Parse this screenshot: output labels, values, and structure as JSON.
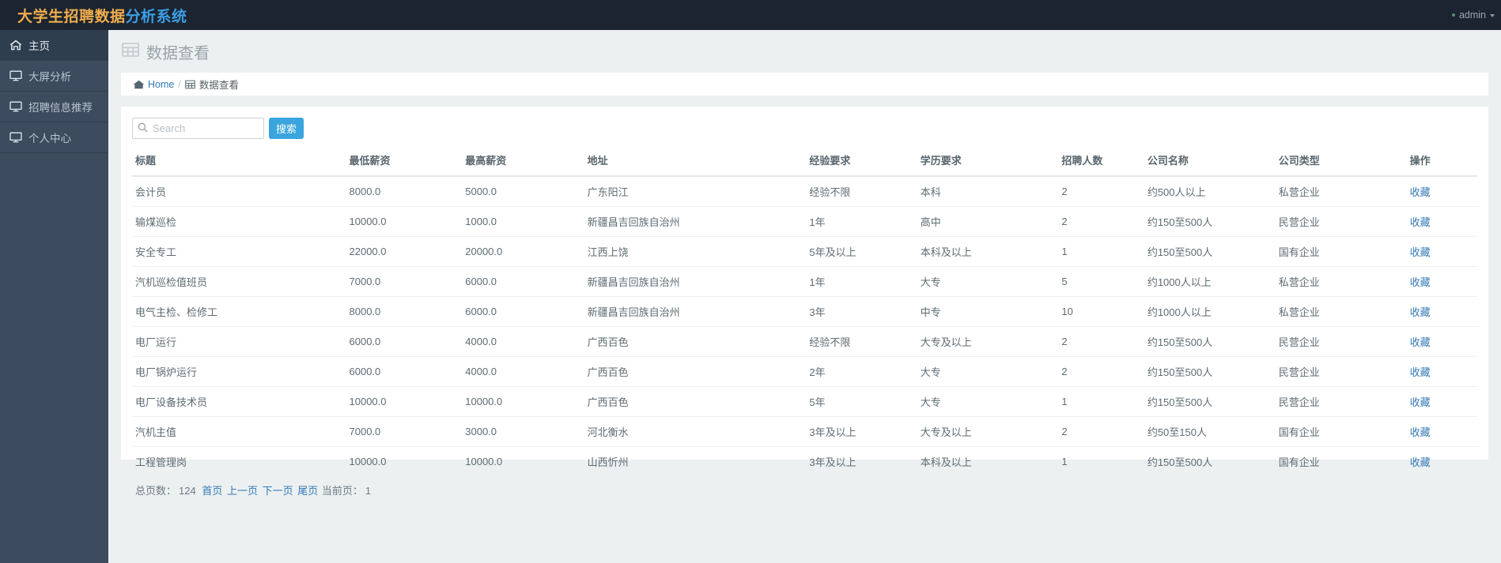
{
  "topbar": {
    "brand_part1": "大学生招聘数据",
    "brand_part2": "分析系统",
    "user_name": "admin"
  },
  "sidebar": {
    "items": [
      {
        "label": "主页",
        "icon": "home-icon",
        "active": true
      },
      {
        "label": "大屏分析",
        "icon": "monitor-icon",
        "active": false
      },
      {
        "label": "招聘信息推荐",
        "icon": "monitor-icon",
        "active": false
      },
      {
        "label": "个人中心",
        "icon": "monitor-icon",
        "active": false
      }
    ]
  },
  "page": {
    "title": "数据查看",
    "title_icon": "table-grid-icon"
  },
  "breadcrumb": {
    "home_label": "Home",
    "separator": "/",
    "current_label": "数据查看"
  },
  "search": {
    "placeholder": "Search",
    "value": "",
    "button_label": "搜索"
  },
  "table": {
    "columns": [
      "标题",
      "最低薪资",
      "最高薪资",
      "地址",
      "经验要求",
      "学历要求",
      "招聘人数",
      "公司名称",
      "公司类型",
      "操作"
    ],
    "action_label": "收藏",
    "rows": [
      [
        "会计员",
        "8000.0",
        "5000.0",
        "广东阳江",
        "经验不限",
        "本科",
        "2",
        "约500人以上",
        "私营企业"
      ],
      [
        "输煤巡检",
        "10000.0",
        "1000.0",
        "新疆昌吉回族自治州",
        "1年",
        "高中",
        "2",
        "约150至500人",
        "民营企业"
      ],
      [
        "安全专工",
        "22000.0",
        "20000.0",
        "江西上饶",
        "5年及以上",
        "本科及以上",
        "1",
        "约150至500人",
        "国有企业"
      ],
      [
        "汽机巡检值班员",
        "7000.0",
        "6000.0",
        "新疆昌吉回族自治州",
        "1年",
        "大专",
        "5",
        "约1000人以上",
        "私营企业"
      ],
      [
        "电气主检、检修工",
        "8000.0",
        "6000.0",
        "新疆昌吉回族自治州",
        "3年",
        "中专",
        "10",
        "约1000人以上",
        "私营企业"
      ],
      [
        "电厂运行",
        "6000.0",
        "4000.0",
        "广西百色",
        "经验不限",
        "大专及以上",
        "2",
        "约150至500人",
        "民营企业"
      ],
      [
        "电厂锅炉运行",
        "6000.0",
        "4000.0",
        "广西百色",
        "2年",
        "大专",
        "2",
        "约150至500人",
        "民营企业"
      ],
      [
        "电厂设备技术员",
        "10000.0",
        "10000.0",
        "广西百色",
        "5年",
        "大专",
        "1",
        "约150至500人",
        "民营企业"
      ],
      [
        "汽机主值",
        "7000.0",
        "3000.0",
        "河北衡水",
        "3年及以上",
        "大专及以上",
        "2",
        "约50至150人",
        "国有企业"
      ],
      [
        "工程管理岗",
        "10000.0",
        "10000.0",
        "山西忻州",
        "3年及以上",
        "本科及以上",
        "1",
        "约150至500人",
        "国有企业"
      ]
    ]
  },
  "pagination": {
    "total_pages_label": "总页数：",
    "total_pages": "124",
    "first_label": "首页",
    "prev_label": "上一页",
    "next_label": "下一页",
    "last_label": "尾页",
    "current_page_label": "当前页：",
    "current_page": "1"
  },
  "colors": {
    "topbar_bg": "#1b2430",
    "sidebar_bg": "#3c4b5e",
    "brand_orange": "#f0ad4e",
    "brand_blue": "#3c9ee5",
    "accent_button": "#39a5dc",
    "link_blue": "#337ab7",
    "page_bg": "#ecf0f1"
  }
}
